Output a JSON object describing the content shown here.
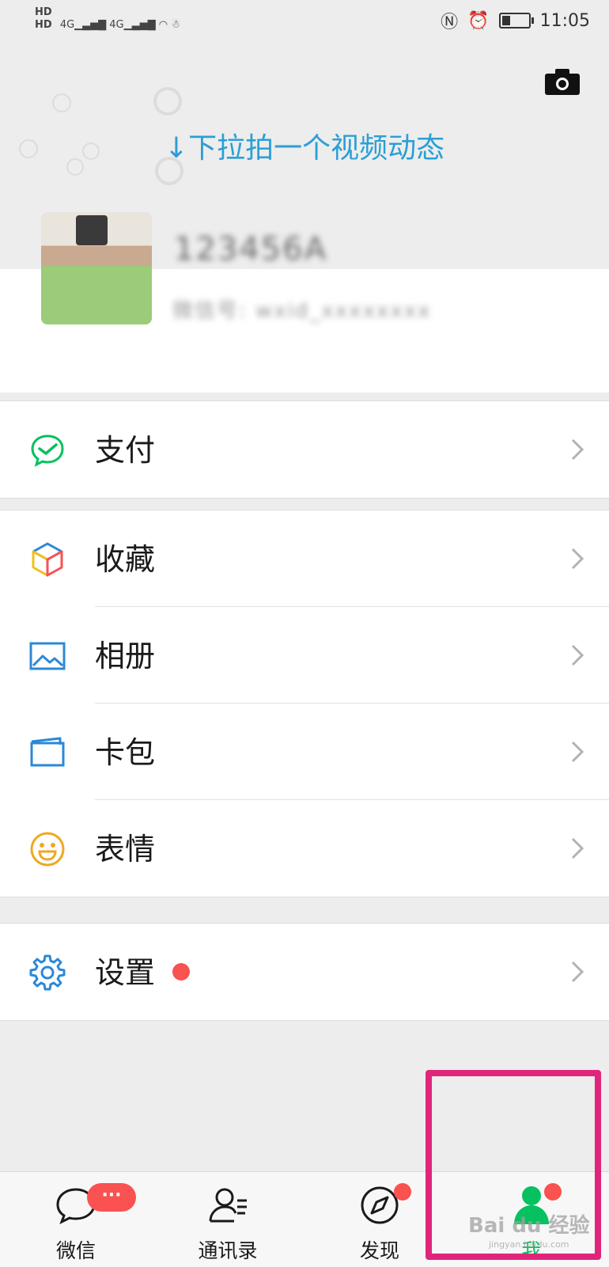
{
  "status_bar": {
    "left_indicators": [
      "HD1",
      "HD2",
      "4G",
      "4G",
      "wifi",
      "qq"
    ],
    "time": "11:05",
    "battery_level": 0.3
  },
  "header": {
    "pull_hint": "↓下拉拍一个视频动态",
    "camera_icon": "camera-icon"
  },
  "profile": {
    "nickname": "123456A",
    "wechat_id": "微信号: wxid_xxxxxxxx"
  },
  "menu": {
    "pay": {
      "label": "支付",
      "icon": "wechat-pay-icon",
      "color": "#07c160"
    },
    "favorites": {
      "label": "收藏",
      "icon": "cube-icon"
    },
    "album": {
      "label": "相册",
      "icon": "image-icon",
      "color": "#2b88d8"
    },
    "cards": {
      "label": "卡包",
      "icon": "card-wallet-icon",
      "color": "#2b88d8"
    },
    "stickers": {
      "label": "表情",
      "icon": "smiley-icon",
      "color": "#f0a81e"
    },
    "settings": {
      "label": "设置",
      "icon": "gear-icon",
      "color": "#2b88d8",
      "has_red_dot": true
    }
  },
  "tabbar": {
    "tabs": [
      {
        "label": "微信",
        "icon": "chat-bubble-icon",
        "badge": "···"
      },
      {
        "label": "通讯录",
        "icon": "contacts-icon"
      },
      {
        "label": "发现",
        "icon": "compass-icon",
        "red_dot": true
      },
      {
        "label": "我",
        "icon": "person-icon",
        "red_dot": true,
        "active": true
      }
    ],
    "active_color": "#07c160"
  },
  "overlay": {
    "highlight_color": "#e0267a",
    "watermark": "Bai du 经验",
    "watermark_url": "jingyan.baidu.com"
  }
}
